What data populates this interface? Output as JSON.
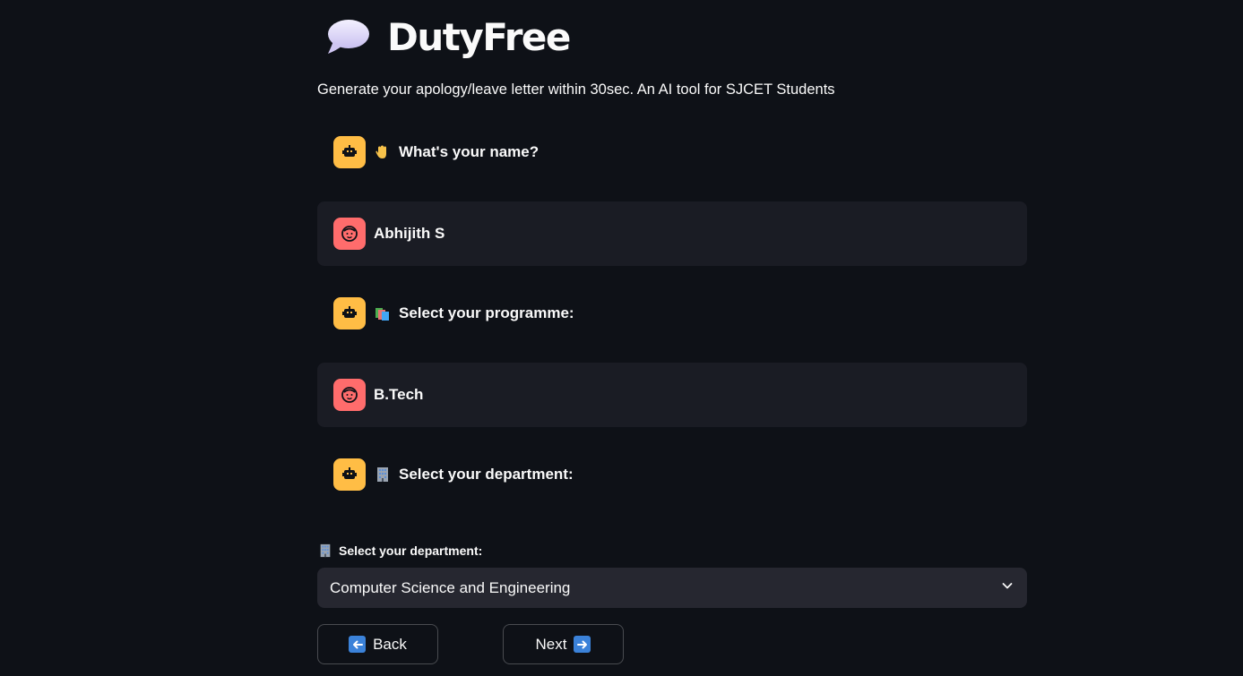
{
  "header": {
    "title": "DutyFree",
    "title_icon": "speech-bubble-icon",
    "subtitle": "Generate your apology/leave letter within 30sec. An AI tool for SJCET Students"
  },
  "chat": {
    "messages": [
      {
        "role": "assistant",
        "emoji": "waving-hand-icon",
        "text": "What's your name?"
      },
      {
        "role": "user",
        "text": "Abhijith S"
      },
      {
        "role": "assistant",
        "emoji": "books-icon",
        "text": "Select your programme:"
      },
      {
        "role": "user",
        "text": "B.Tech"
      },
      {
        "role": "assistant",
        "emoji": "office-building-icon",
        "text": "Select your department:"
      }
    ]
  },
  "department_select": {
    "label": "Select your department:",
    "label_icon": "office-building-icon",
    "value": "Computer Science and Engineering"
  },
  "buttons": {
    "back_label": "Back",
    "back_icon": "left-arrow-icon",
    "next_label": "Next",
    "next_icon": "right-arrow-icon"
  },
  "colors": {
    "background": "#0e1117",
    "user_message_bg": "#1a1c24",
    "assistant_avatar": "#ffbd45",
    "user_avatar": "#ff6c6c",
    "select_bg": "#262730"
  }
}
